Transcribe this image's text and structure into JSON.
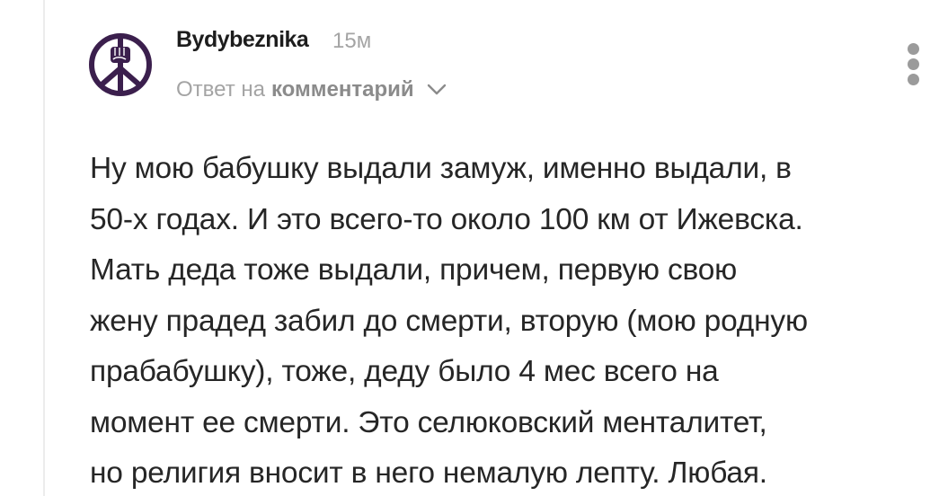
{
  "comment": {
    "author": "Bydybeznika",
    "time": "15м",
    "reply_prefix": "Ответ на",
    "reply_link": "комментарий",
    "avatar_icon": "peace-fist-icon",
    "accent_color": "#3b1f4d",
    "body_lines": [
      "Ну мою бабушку выдали замуж, именно выдали, в",
      "50-х годах. И это всего-то около 100 км от Ижевска.",
      "Мать деда тоже выдали, причем, первую свою",
      "жену прадед забил до смерти, вторую (мою родную",
      "прабабушку), тоже, деду было 4 мес всего на",
      "момент ее смерти. Это селюковский менталитет,",
      "но религия вносит в него немалую лепту. Любая."
    ]
  },
  "icons": {
    "chevron": "chevron-down-icon",
    "menu": "more-vertical-icon"
  }
}
